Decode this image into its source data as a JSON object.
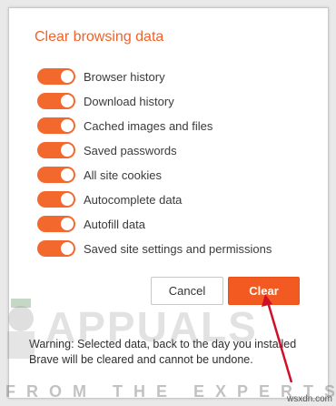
{
  "dialog": {
    "title": "Clear browsing data",
    "options": [
      {
        "label": "Browser history",
        "checked": true
      },
      {
        "label": "Download history",
        "checked": true
      },
      {
        "label": "Cached images and files",
        "checked": true
      },
      {
        "label": "Saved passwords",
        "checked": true
      },
      {
        "label": "All site cookies",
        "checked": true
      },
      {
        "label": "Autocomplete data",
        "checked": true
      },
      {
        "label": "Autofill data",
        "checked": true
      },
      {
        "label": "Saved site settings and permissions",
        "checked": true
      }
    ],
    "cancel_label": "Cancel",
    "clear_label": "Clear",
    "warning": "Warning: Selected data, back to the day you installed Brave will be cleared and cannot be undone."
  },
  "watermark": {
    "brand": "APPUALS",
    "tagline": "FROM THE EXPERTS!",
    "site": "wsxdn.com"
  },
  "colors": {
    "accent": "#f3682d",
    "clear_button": "#f25a22",
    "arrow": "#d0102a"
  }
}
